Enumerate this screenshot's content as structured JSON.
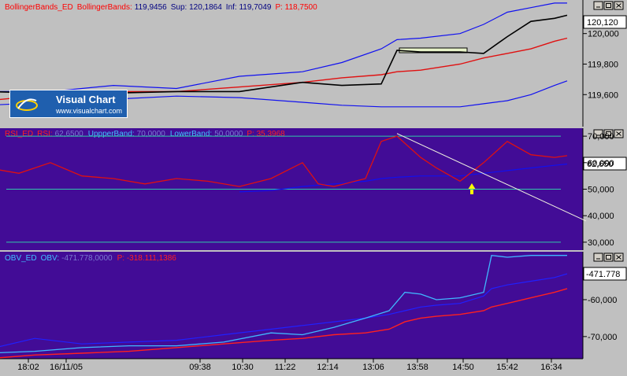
{
  "colors": {
    "top_bg": "#c0c0c0",
    "indicator_bg": "#420c96",
    "price": "#000000",
    "upper_band": "#1010f0",
    "mid_band": "#e01010",
    "rsi_line": "#e01010",
    "rsi_guides": "#30c8a8",
    "obv_line": "#40b8ff",
    "obv_upper": "#2020ff",
    "obv_mid": "#ff2020",
    "value_box_bg": "#ffffff"
  },
  "icons": [
    "minimize-icon",
    "maximize-icon",
    "close-icon",
    "arrow-up-icon"
  ],
  "logo": {
    "title": "Visual Chart",
    "url": "www.visualchart.com"
  },
  "panels": {
    "price": {
      "header": {
        "name": "BollingerBands_ED",
        "ind": "BollingerBands:",
        "ind_val": "119,9456",
        "sup": "Sup: 120,1864",
        "inf": "Inf: 119,7049",
        "p": "P: 118,7500"
      },
      "last_value": "120,120"
    },
    "rsi": {
      "header": {
        "name": "RSI_ED",
        "ind": "RSI:",
        "ind_val": "62,6500",
        "upper": "UppperBand:",
        "upper_val": "70,0000",
        "lower": "LowerBand:",
        "lower_val": "50,0000",
        "p": "P: 35,3968"
      },
      "last_value": "62,650"
    },
    "obv": {
      "header": {
        "name": "OBV_ED",
        "ind": "OBV:",
        "ind_val": "-471.778,0000",
        "p": "P: -318.111,1386"
      },
      "last_value": "-471.778"
    }
  },
  "chart_data": [
    {
      "type": "line",
      "panel": "price",
      "y_ticks": [
        "119,600",
        "119,800",
        "120,000"
      ],
      "y_tick_values": [
        119.6,
        119.8,
        120.0
      ],
      "ylim": [
        119.39,
        120.22
      ],
      "x": [
        0,
        40,
        80,
        120,
        160,
        200,
        225,
        250,
        260,
        275,
        300,
        315,
        330,
        345,
        360,
        368
      ],
      "series": [
        {
          "name": "BollingerBands",
          "values": [
            119.56,
            119.6,
            119.62,
            119.62,
            119.65,
            119.68,
            119.71,
            119.73,
            119.75,
            119.76,
            119.8,
            119.84,
            119.87,
            119.9,
            119.95,
            119.97
          ]
        },
        {
          "name": "Sup",
          "values": [
            119.62,
            119.62,
            119.66,
            119.64,
            119.72,
            119.75,
            119.81,
            119.9,
            119.96,
            119.97,
            120.0,
            120.06,
            120.14,
            120.17,
            120.2,
            120.2
          ]
        },
        {
          "name": "Inf",
          "values": [
            119.53,
            119.55,
            119.57,
            119.59,
            119.58,
            119.55,
            119.53,
            119.52,
            119.52,
            119.52,
            119.52,
            119.54,
            119.56,
            119.6,
            119.66,
            119.69
          ]
        },
        {
          "name": "Price",
          "values": [
            119.62,
            119.61,
            119.61,
            119.62,
            119.62,
            119.68,
            119.66,
            119.67,
            119.89,
            119.88,
            119.88,
            119.87,
            119.98,
            120.08,
            120.1,
            120.12
          ]
        }
      ],
      "annotations": [
        "resistance-bar"
      ]
    },
    {
      "type": "line",
      "panel": "rsi",
      "y_ticks": [
        "30,000",
        "40,000",
        "50,000",
        "60,000",
        "70,000"
      ],
      "y_tick_values": [
        30,
        40,
        50,
        60,
        70
      ],
      "ylim": [
        27,
        73
      ],
      "guides": [
        70,
        50,
        30
      ],
      "x": [
        0,
        20,
        40,
        60,
        80,
        100,
        120,
        140,
        160,
        180,
        200,
        210,
        220,
        240,
        250,
        260,
        275,
        285,
        300,
        315,
        330,
        345,
        360,
        368
      ],
      "series": [
        {
          "name": "RSI",
          "values": [
            58,
            56,
            60,
            55,
            54,
            52,
            54,
            53,
            51,
            54,
            60,
            52,
            51,
            54,
            68,
            70,
            62,
            58,
            53,
            60,
            68,
            63,
            62,
            62.65
          ]
        },
        {
          "name": "LowerBandLine",
          "values": [
            null,
            null,
            null,
            null,
            null,
            null,
            null,
            null,
            49,
            49.5,
            51,
            51.5,
            52,
            53,
            54,
            54.5,
            55,
            55,
            55,
            56,
            57,
            58,
            59,
            59.5
          ]
        }
      ],
      "trendline": [
        [
          260,
          71
        ],
        [
          380,
          38
        ]
      ],
      "annotations": [
        "arrow-up"
      ]
    },
    {
      "type": "line",
      "panel": "obv",
      "y_ticks": [
        "-70,000",
        "-60,000"
      ],
      "y_tick_values": [
        -70,
        -60
      ],
      "ylim": [
        -76,
        -47
      ],
      "x": [
        0,
        30,
        60,
        90,
        120,
        150,
        180,
        200,
        220,
        240,
        255,
        265,
        275,
        285,
        300,
        315,
        320,
        330,
        345,
        360,
        368
      ],
      "series": [
        {
          "name": "OBV",
          "values": [
            -74.5,
            -74,
            -73,
            -72.5,
            -72.5,
            -71.5,
            -69,
            -69.5,
            -67.5,
            -65,
            -63,
            -58,
            -58.5,
            -60,
            -59.5,
            -58,
            -48,
            -48.5,
            -48,
            -48,
            -48
          ]
        },
        {
          "name": "OBV_upper",
          "values": [
            -73.5,
            -70.5,
            -72,
            -71.5,
            -71,
            -69.5,
            -68,
            -67,
            -66,
            -65,
            -64,
            -63,
            -62,
            -61.5,
            -61,
            -59,
            -57,
            -56,
            -55,
            -54,
            -53
          ]
        },
        {
          "name": "OBV_mid",
          "values": [
            -76,
            -75,
            -74.5,
            -74,
            -73,
            -72,
            -71,
            -70.5,
            -69.5,
            -69,
            -68,
            -66,
            -65,
            -64.5,
            -64,
            -63,
            -62,
            -61,
            -59.5,
            -58,
            -57
          ]
        }
      ]
    },
    {
      "type": "axis",
      "panel": "time-axis",
      "tick_labels": [
        "18:02",
        "16/11/05",
        "09:38",
        "10:30",
        "11:22",
        "12:14",
        "13:06",
        "13:58",
        "14:50",
        "15:42",
        "16:34"
      ],
      "tick_x": [
        0,
        24,
        109,
        136,
        163,
        190,
        219,
        247,
        276,
        304,
        332
      ]
    }
  ]
}
